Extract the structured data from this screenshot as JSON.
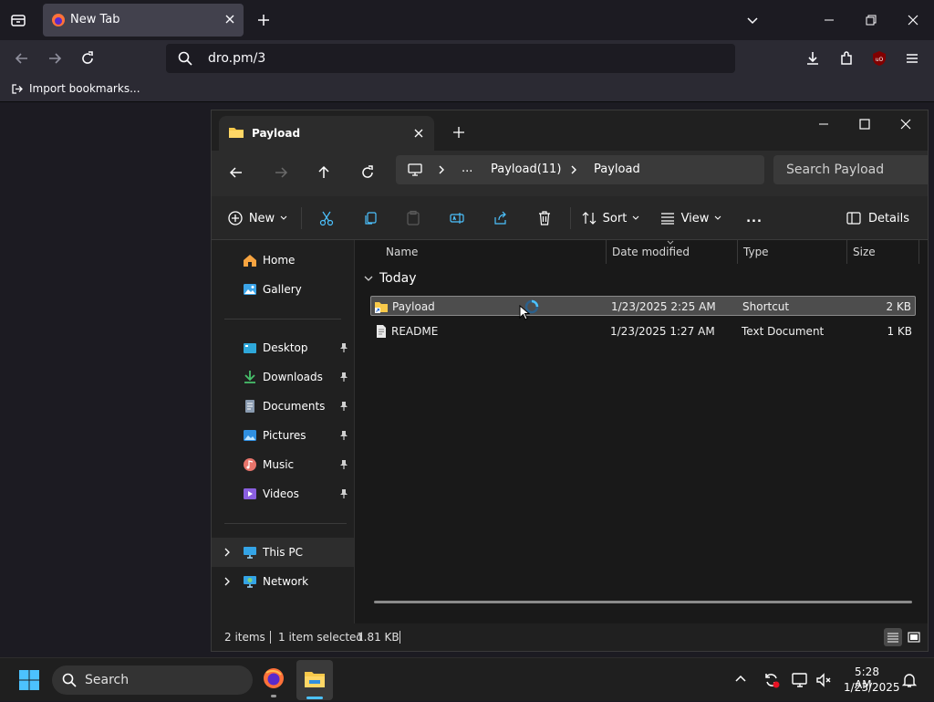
{
  "browser": {
    "tab_title": "New Tab",
    "url": "dro.pm/3",
    "bookmarks_import": "Import bookmarks..."
  },
  "explorer": {
    "tab_title": "Payload",
    "breadcrumb": [
      "...",
      "Payload(11)",
      "Payload"
    ],
    "search_placeholder": "Search Payload",
    "toolbar": {
      "new_label": "New",
      "sort_label": "Sort",
      "view_label": "View",
      "more_label": "...",
      "details_label": "Details"
    },
    "nav": {
      "items": [
        {
          "label": "Home",
          "icon": "home-icon"
        },
        {
          "label": "Gallery",
          "icon": "gallery-icon"
        },
        {
          "label": "Desktop",
          "icon": "desktop-icon",
          "pinned": true
        },
        {
          "label": "Downloads",
          "icon": "downloads-icon",
          "pinned": true
        },
        {
          "label": "Documents",
          "icon": "documents-icon",
          "pinned": true
        },
        {
          "label": "Pictures",
          "icon": "pictures-icon",
          "pinned": true
        },
        {
          "label": "Music",
          "icon": "music-icon",
          "pinned": true
        },
        {
          "label": "Videos",
          "icon": "videos-icon",
          "pinned": true
        },
        {
          "label": "This PC",
          "icon": "this-pc-icon"
        },
        {
          "label": "Network",
          "icon": "network-icon"
        }
      ]
    },
    "columns": [
      "Name",
      "Date modified",
      "Type",
      "Size"
    ],
    "group_label": "Today",
    "files": [
      {
        "name": "Payload",
        "date": "1/23/2025 2:25 AM",
        "type": "Shortcut",
        "size": "2 KB",
        "selected": true
      },
      {
        "name": "README",
        "date": "1/23/2025 1:27 AM",
        "type": "Text Document",
        "size": "1 KB",
        "selected": false
      }
    ],
    "status": {
      "item_count": "2 items",
      "selection": "1 item selected",
      "selection_size": "1.81 KB"
    }
  },
  "taskbar": {
    "search_placeholder": "Search",
    "time": "5:28 AM",
    "date": "1/23/2025"
  },
  "colors": {
    "accent": "#4cc2ff",
    "selection": "#4d4d4d",
    "folder": "#f8c94a"
  }
}
